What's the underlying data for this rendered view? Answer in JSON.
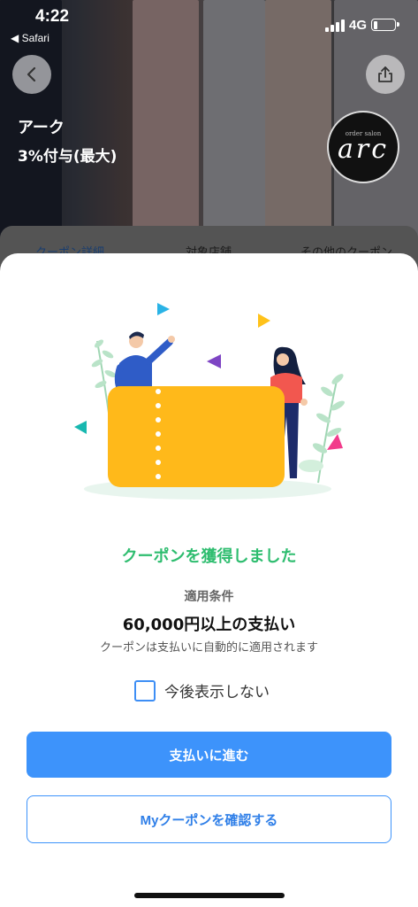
{
  "status_bar": {
    "time": "4:22",
    "back_app": "◀ Safari",
    "network": "4G",
    "battery_level": 0.2
  },
  "store": {
    "name": "アーク",
    "points": "3%付与(最大)",
    "logo_small": "order salon",
    "logo_text": "arc"
  },
  "tabs": [
    {
      "label": "クーポン詳細",
      "active": true
    },
    {
      "label": "対象店舗",
      "active": false
    },
    {
      "label": "その他のクーポン",
      "active": false
    }
  ],
  "sheet": {
    "title": "クーポンを獲得しました",
    "condition_label": "適用条件",
    "condition_value": "60,000円以上の支払い",
    "condition_note": "クーポンは支払いに自動的に適用されます",
    "dont_show_label": "今後表示しない",
    "dont_show_checked": false,
    "primary_button": "支払いに進む",
    "secondary_button": "Myクーポンを確認する"
  },
  "icons": {
    "back": "chevron-left-icon",
    "share": "share-icon"
  },
  "colors": {
    "accent_blue": "#3d93fb",
    "success_green": "#2ebd6f",
    "ticket_yellow": "#ffb91a"
  }
}
